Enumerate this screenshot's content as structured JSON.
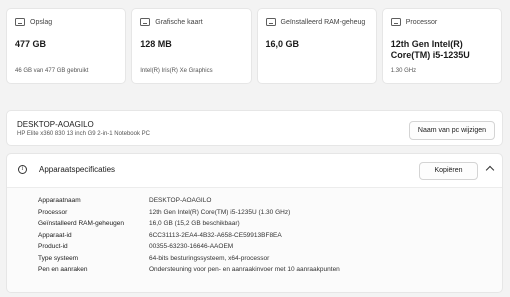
{
  "cards": [
    {
      "icon": "storage-icon",
      "label": "Opslag",
      "value": "477 GB",
      "sub": "46 GB van 477 GB gebruikt"
    },
    {
      "icon": "graphics-card-icon",
      "label": "Grafische kaart",
      "value": "128 MB",
      "sub": "Intel(R) Iris(R) Xe Graphics"
    },
    {
      "icon": "ram-icon",
      "label": "Geïnstalleerd RAM-geheug",
      "value": "16,0 GB",
      "sub": ""
    },
    {
      "icon": "processor-icon",
      "label": "Processor",
      "value": "12th Gen Intel(R) Core(TM) i5-1235U",
      "sub": "1.30 GHz"
    }
  ],
  "device": {
    "name": "DESKTOP-AOAGILO",
    "model": "HP Elite x360 830 13 inch G9 2-in-1 Notebook PC",
    "rename_label": "Naam van pc wijzigen"
  },
  "specs": {
    "title": "Apparaatspecificaties",
    "copy_label": "Kopiëren",
    "rows": [
      {
        "label": "Apparaatnaam",
        "value": "DESKTOP-AOAGILO"
      },
      {
        "label": "Processor",
        "value": "12th Gen Intel(R) Core(TM) i5-1235U (1.30 GHz)"
      },
      {
        "label": "Geïnstalleerd RAM-geheugen",
        "value": "16,0 GB (15,2 GB beschikbaar)"
      },
      {
        "label": "Apparaat-id",
        "value": "6CC31113-2EA4-4B32-A658-CE59913BF8EA"
      },
      {
        "label": "Product-id",
        "value": "00355-63230-16646-AAOEM"
      },
      {
        "label": "Type systeem",
        "value": "64-bits besturingssysteem, x64-processor"
      },
      {
        "label": "Pen en aanraken",
        "value": "Ondersteuning voor pen- en aanraakinvoer met 10 aanraakpunten"
      }
    ]
  }
}
